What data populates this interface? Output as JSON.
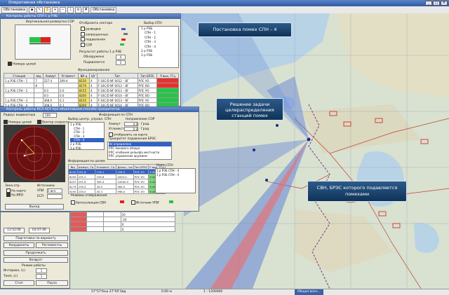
{
  "window": {
    "title": "Оперативная обстановка"
  },
  "toolbar": {
    "menu_label": "Обстановка",
    "combo_value": "Обстановка"
  },
  "callouts": {
    "c1": "Постановка помех СПН – 4",
    "c2": "Решение задачи целераспределения станций помех",
    "c3": "СВН, БРЭС которого подавляется помехами"
  },
  "panel1": {
    "title": "Контроль работы СПН 1 р РЭБ",
    "diagram_label": "Вертикальная развертка СОР",
    "legend_title": "Отобразить сектора",
    "legend": [
      "разведки",
      "запрещенные",
      "подавления",
      "СОР"
    ],
    "spn_title": "Выбор СПН",
    "spn_tree": [
      "1 р РЭБ",
      "СПН - 1",
      "СПН - 2",
      "СПН - 3",
      "СПН - 4",
      "2 р РЭБ",
      "3 р РЭБ"
    ],
    "result_title": "Результат работы 1 р РЭБ",
    "detected_label": "Обнаружено",
    "detected_value": "4",
    "suppressed_label": "Подавляется",
    "suppressed_value": "2",
    "targets_check": "Номера целей",
    "func_label": "Функционирование",
    "cols": [
      "Станция",
      "№ц",
      "Азимут",
      "Угломест",
      "ВИ ц",
      "ЦУ",
      "Тип",
      "Тип БРЭС",
      "Р вых, ГГц"
    ],
    "rows": [
      [
        "1 р РЭБ СПН - 1",
        "7",
        "227.4",
        "269.4",
        "8150",
        "4",
        "F-16C/D NF-0012 – ВГ",
        "РЛС УО",
        ""
      ],
      [
        "",
        "8",
        "",
        "",
        "8170",
        "4",
        "F-16C/D NF-0013 – ВГ",
        "РЛС ВО",
        ""
      ],
      [
        "1 р РЭБ СПН - 2",
        "",
        "0.0",
        "0.0",
        "8155",
        "4",
        "F-16C/D NF-0013 – ВГ",
        "РЛС УО",
        ""
      ],
      [
        "",
        "",
        "0.0",
        "0.0",
        "8200",
        "4",
        "F-16C/D NF-0014 – ВГ",
        "РЛС ВО",
        ""
      ],
      [
        "1 р РЭБ СПН - 3",
        "",
        "368.0",
        "0.1",
        "8155",
        "4",
        "F-16C/D NF-0013 – ВГ",
        "РЛС УО",
        ""
      ],
      [
        "1 р РЭБ СПН - 4",
        "",
        "308.0",
        "0.1",
        "8200",
        "4",
        "F-16C/D NF-0014 – ВГ",
        "РЛС ВО",
        ""
      ]
    ]
  },
  "panel2": {
    "title": "Контроль работы КСА АСУ при объективном способе приоритетов.",
    "radar_label": "Радиус индикатора",
    "radar_value": "100",
    "targets_check": "Номера целей",
    "speed_check": "Вектор скорости",
    "spn_info_title": "Информация по СПН",
    "device_label": "Выбор центр. управл. СПН",
    "tree": [
      "1 р РЭБ",
      "СПН - 1",
      "СПН - 2",
      "СПН - 3",
      "СПН - 4",
      "2 р РЭБ",
      "3 р РЭБ"
    ],
    "sor_label": "Направление СОР",
    "azimuth_label": "Азимут",
    "azimuth_value": "0.0",
    "azimuth_unit": "Град.",
    "elev_label": "Угломест",
    "elev_value": "0.0",
    "elev_unit": "Град.",
    "show_map": "отобразить на карте",
    "brs_label": "Приоритет подавления БРЭС",
    "brs_items": [
      "Не определено",
      "РЛС бокового обзора",
      "РЛС огибания рельефа местности",
      "РЛС управления оружием"
    ],
    "target_info": "Информация по целям",
    "tcols": [
      "№ц",
      "Азимут, Гр.",
      "Угломест, Гр.",
      "Дальн., км",
      "Тип БРЭС",
      "Р вых, ГГц"
    ],
    "trows": [
      [
        "8150",
        "251.8",
        "178.1",
        "199.5",
        "РЛС УО",
        "9.45"
      ],
      [
        "8255",
        "231.2",
        "159.6",
        "2000.0",
        "РЛС УО",
        "9.40"
      ],
      [
        "8207",
        "251.6",
        "305.4",
        "10000.0",
        "РЛС УО",
        "9.45"
      ],
      [
        "8179",
        "239.4",
        "34.9",
        "560.0",
        "РЛС УО",
        "9.40"
      ],
      [
        "8195",
        "235.0",
        "45.3",
        "998.0",
        "РЛС УО",
        "9.45"
      ]
    ],
    "naz_title": "Назн. СПН",
    "naz_items": [
      "1 р РЭБ СПН - 4",
      "1 р РЭБ СПН - 4"
    ],
    "mode_label": "Режимы отображения",
    "auto_label": "Автоселекция СВН",
    "source_label": "Источник УПИ",
    "zone_label": "Зона отр.",
    "map_check": "На карте",
    "ind_check": "На ИКО",
    "src_title": "Источники",
    "upi_label": "УПИ",
    "upi_value": "2 вкл.",
    "esp_label": "ЕСП",
    "esp_value": "",
    "exit_button": "Выход"
  },
  "left_bottom": {
    "time": "13:52:06",
    "date": "02-07-06",
    "btn_prep": "Подготовка по варианту",
    "btn_coord": "Координаты",
    "btn_regl": "Регламенты",
    "btn_continue": "Продолжить",
    "btn_return": "Возврат",
    "mode_label": "Режим работы",
    "interval_label": "Интервал, (с)",
    "interval_value": "1",
    "scale_label": "Темп, (с)",
    "scale_value": "1",
    "btn_stop": "Стоп",
    "btn_pause": "Пауза",
    "list_col": [
      "",
      "",
      "",
      ""
    ],
    "list_rows": [
      [
        "",
        "",
        "",
        "10"
      ],
      [
        "",
        "",
        "",
        "-34"
      ],
      [
        "",
        "",
        "",
        "0"
      ],
      [
        "",
        "",
        "",
        "4"
      ]
    ]
  },
  "status": {
    "coords": "57°57'6сш 27°05'3вд",
    "alt": "0.00 м",
    "scale": "1 : 1200000"
  },
  "taskbar": {
    "item": "Общая воен..."
  }
}
